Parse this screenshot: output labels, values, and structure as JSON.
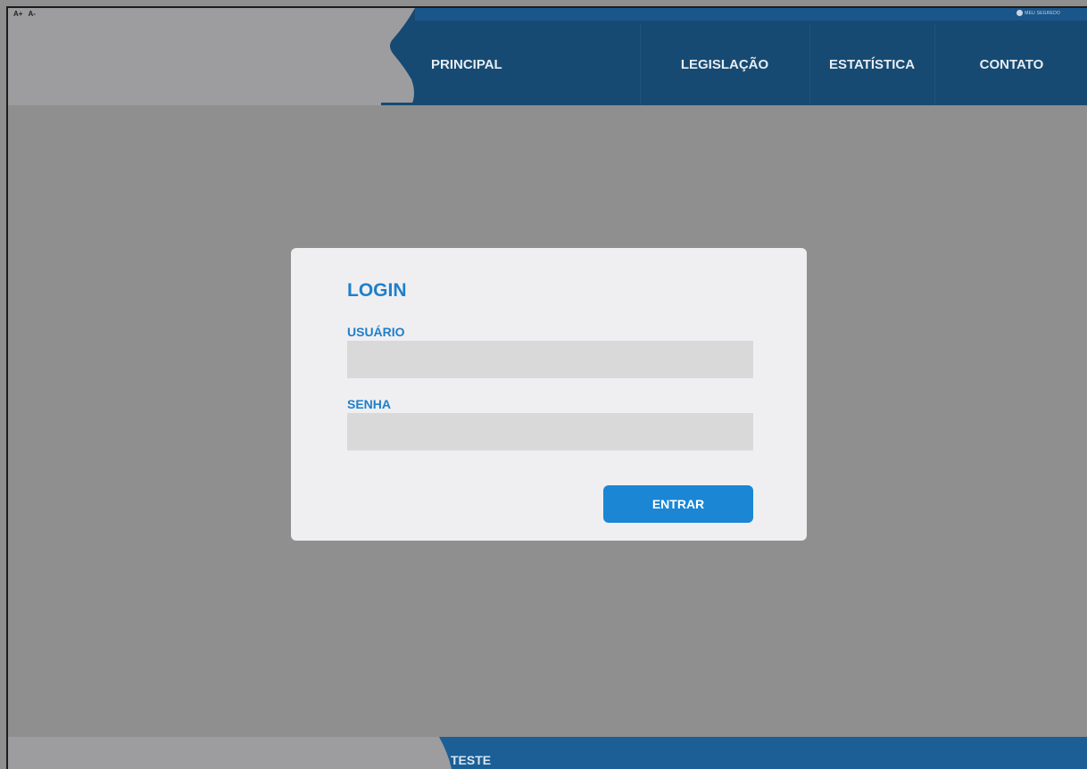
{
  "header": {
    "font_increase": "A+",
    "font_decrease": "A-",
    "account_label": "MEU SEGREDO",
    "nav": [
      {
        "label": "PRINCIPAL"
      },
      {
        "label": "LEGISLAÇÃO"
      },
      {
        "label": "ESTATÍSTICA"
      },
      {
        "label": "CONTATO"
      }
    ]
  },
  "login": {
    "title": "LOGIN",
    "user_label": "USUÁRIO",
    "user_value": "",
    "pass_label": "SENHA",
    "pass_value": "",
    "submit_label": "ENTRAR"
  },
  "footer": {
    "label": "TESTE"
  },
  "colors": {
    "nav_blue": "#174a72",
    "accent_blue": "#1a86d4",
    "label_blue": "#1e7fc9",
    "card_bg": "#efeff2",
    "input_bg": "#d9d9d9",
    "overlay_gray": "#8f8f8f"
  }
}
